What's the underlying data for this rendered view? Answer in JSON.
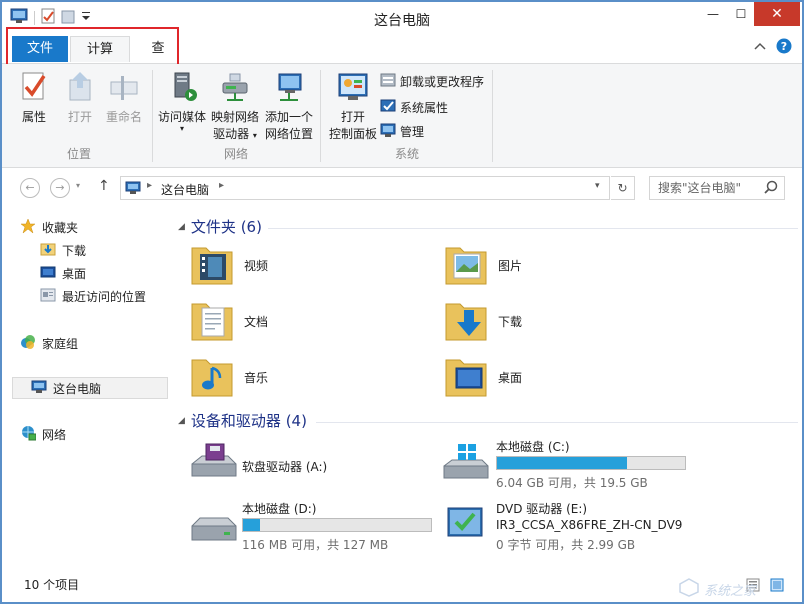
{
  "window": {
    "title": "这台电脑",
    "close_glyph": "✕",
    "min_glyph": "—",
    "max_glyph": "☐"
  },
  "tabs": [
    {
      "label": "文件"
    },
    {
      "label": "计算机"
    },
    {
      "label": "查看"
    }
  ],
  "ribbon": {
    "location_group": {
      "label": "位置",
      "buttons": [
        {
          "label": "属性"
        },
        {
          "label": "打开"
        },
        {
          "label": "重命名"
        }
      ]
    },
    "network_group": {
      "label": "网络",
      "buttons": [
        {
          "label": "访问媒体"
        },
        {
          "label_1": "映射网络",
          "label_2": "驱动器"
        },
        {
          "label_1": "添加一个",
          "label_2": "网络位置"
        }
      ]
    },
    "system_group": {
      "label": "系统",
      "open_panel": {
        "label_1": "打开",
        "label_2": "控制面板"
      },
      "small": [
        {
          "label": "卸载或更改程序"
        },
        {
          "label": "系统属性"
        },
        {
          "label": "管理"
        }
      ]
    }
  },
  "address": {
    "path": "这台电脑",
    "refresh_glyph": "↻",
    "search_placeholder": "搜索\"这台电脑\""
  },
  "nav": {
    "favorites": "收藏夹",
    "downloads": "下载",
    "desktop": "桌面",
    "recent": "最近访问的位置",
    "homegroup": "家庭组",
    "this_pc": "这台电脑",
    "network": "网络"
  },
  "folders_section": {
    "title": "文件夹 (6)",
    "items": [
      {
        "name": "视频"
      },
      {
        "name": "图片"
      },
      {
        "name": "文档"
      },
      {
        "name": "下载"
      },
      {
        "name": "音乐"
      },
      {
        "name": "桌面"
      }
    ]
  },
  "drives_section": {
    "title": "设备和驱动器 (4)",
    "floppy": {
      "name": "软盘驱动器 (A:)"
    },
    "c_drive": {
      "name": "本地磁盘 (C:)",
      "usage": "6.04 GB 可用，共 19.5 GB",
      "used_fraction": 0.69
    },
    "d_drive": {
      "name": "本地磁盘 (D:)",
      "usage": "116 MB 可用，共 127 MB",
      "used_fraction": 0.09
    },
    "dvd": {
      "name": "DVD 驱动器 (E:)",
      "label": "IR3_CCSA_X86FRE_ZH-CN_DV9",
      "usage": "0 字节 可用，共 2.99 GB"
    }
  },
  "status": {
    "item_count": "10 个项目"
  },
  "watermark": {
    "text": "系统之家"
  },
  "colors": {
    "accent": "#1979ca",
    "section_title": "#1e3287",
    "highlight_box": "#e0262b",
    "drive_bar": "#26a0da"
  }
}
